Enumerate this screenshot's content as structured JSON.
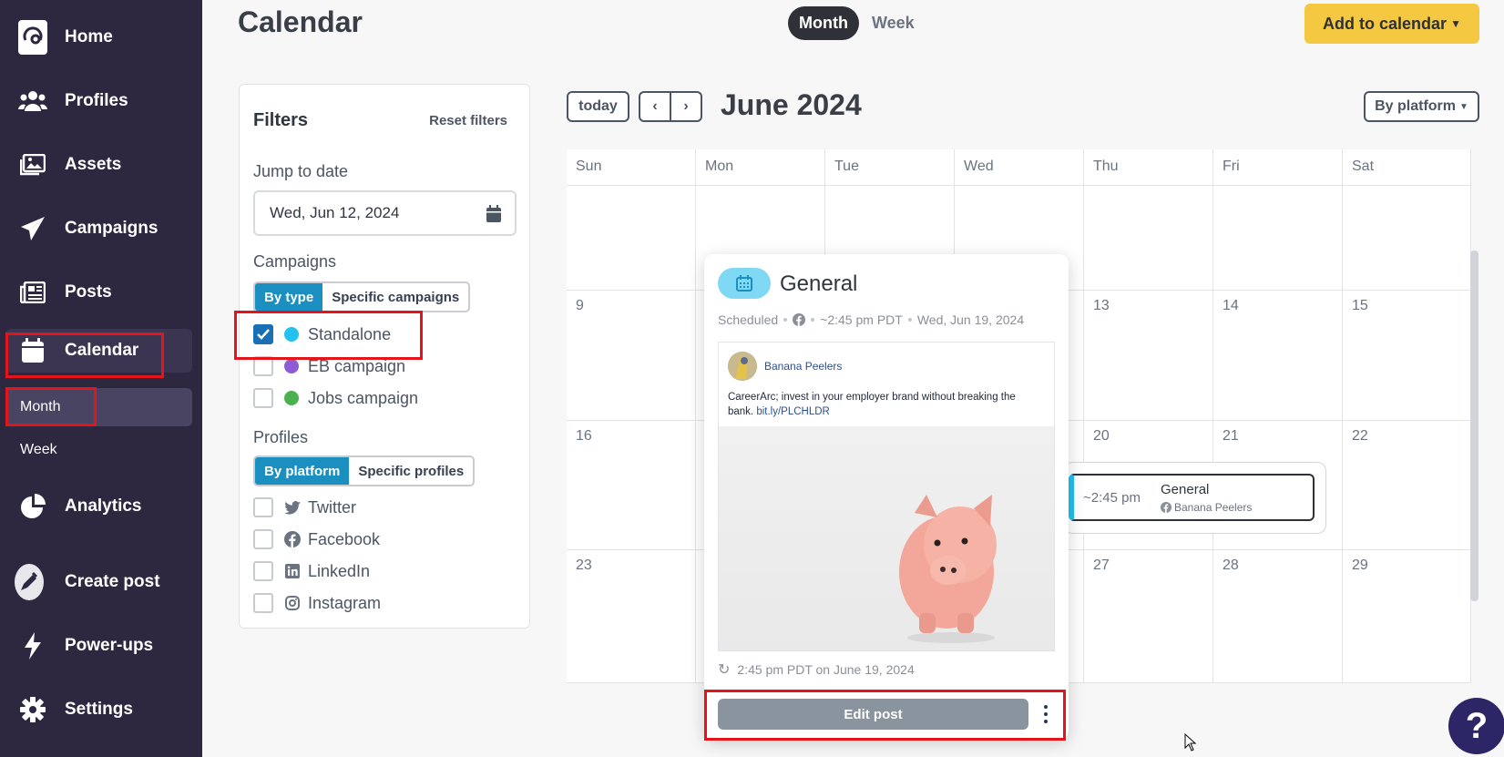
{
  "sidebar": {
    "items": [
      {
        "label": "Home",
        "icon": "logo-icon"
      },
      {
        "label": "Profiles",
        "icon": "users-icon"
      },
      {
        "label": "Assets",
        "icon": "image-icon"
      },
      {
        "label": "Campaigns",
        "icon": "send-icon"
      },
      {
        "label": "Posts",
        "icon": "newspaper-icon"
      },
      {
        "label": "Calendar",
        "icon": "calendar-icon"
      },
      {
        "label": "Analytics",
        "icon": "pie-chart-icon"
      },
      {
        "label": "Create post",
        "icon": "pen-icon"
      },
      {
        "label": "Power-ups",
        "icon": "bolt-icon"
      },
      {
        "label": "Settings",
        "icon": "gear-icon"
      }
    ],
    "calendar_sub": {
      "month": "Month",
      "week": "Week"
    }
  },
  "header": {
    "title": "Calendar",
    "view_month": "Month",
    "view_week": "Week",
    "add_button": "Add to calendar"
  },
  "filters": {
    "title": "Filters",
    "reset": "Reset filters",
    "jump_label": "Jump to date",
    "date_value": "Wed, Jun 12, 2024",
    "campaigns_label": "Campaigns",
    "campaign_tabs": [
      "By type",
      "Specific campaigns"
    ],
    "campaigns": [
      {
        "label": "Standalone",
        "color": "#22c1ef",
        "checked": true
      },
      {
        "label": "EB campaign",
        "color": "#8e5bd6",
        "checked": false
      },
      {
        "label": "Jobs campaign",
        "color": "#4caf50",
        "checked": false
      }
    ],
    "profiles_label": "Profiles",
    "profile_tabs": [
      "By platform",
      "Specific profiles"
    ],
    "platforms": [
      {
        "label": "Twitter",
        "icon": "twitter-icon"
      },
      {
        "label": "Facebook",
        "icon": "facebook-icon"
      },
      {
        "label": "LinkedIn",
        "icon": "linkedin-icon"
      },
      {
        "label": "Instagram",
        "icon": "instagram-icon"
      }
    ]
  },
  "calendar": {
    "today": "today",
    "month_title": "June 2024",
    "group_by": "By platform",
    "days": [
      "Sun",
      "Mon",
      "Tue",
      "Wed",
      "Thu",
      "Fri",
      "Sat"
    ],
    "weeks": [
      [
        "",
        "",
        "",
        "",
        "",
        "",
        ""
      ],
      [
        "9",
        "",
        "",
        "",
        "13",
        "14",
        "15"
      ],
      [
        "16",
        "",
        "",
        "",
        "20",
        "21",
        "22"
      ],
      [
        "23",
        "",
        "",
        "",
        "27",
        "28",
        "29"
      ]
    ]
  },
  "event": {
    "time": "~2:45 pm",
    "name": "General",
    "profile": "Banana Peelers"
  },
  "popup": {
    "title": "General",
    "status": "Scheduled",
    "time": "~2:45 pm PDT",
    "date": "Wed, Jun 19, 2024",
    "profile_name": "Banana Peelers",
    "post_text": "CareerArc; invest in your employer brand without breaking the bank.",
    "post_link": "bit.ly/PLCHLDR",
    "schedule": "2:45 pm PDT on June 19, 2024",
    "edit_button": "Edit post"
  },
  "colors": {
    "sidebar": "#2d2840",
    "accent": "#1a8fc0",
    "add_button": "#f5c842",
    "standalone": "#22c1ef"
  }
}
